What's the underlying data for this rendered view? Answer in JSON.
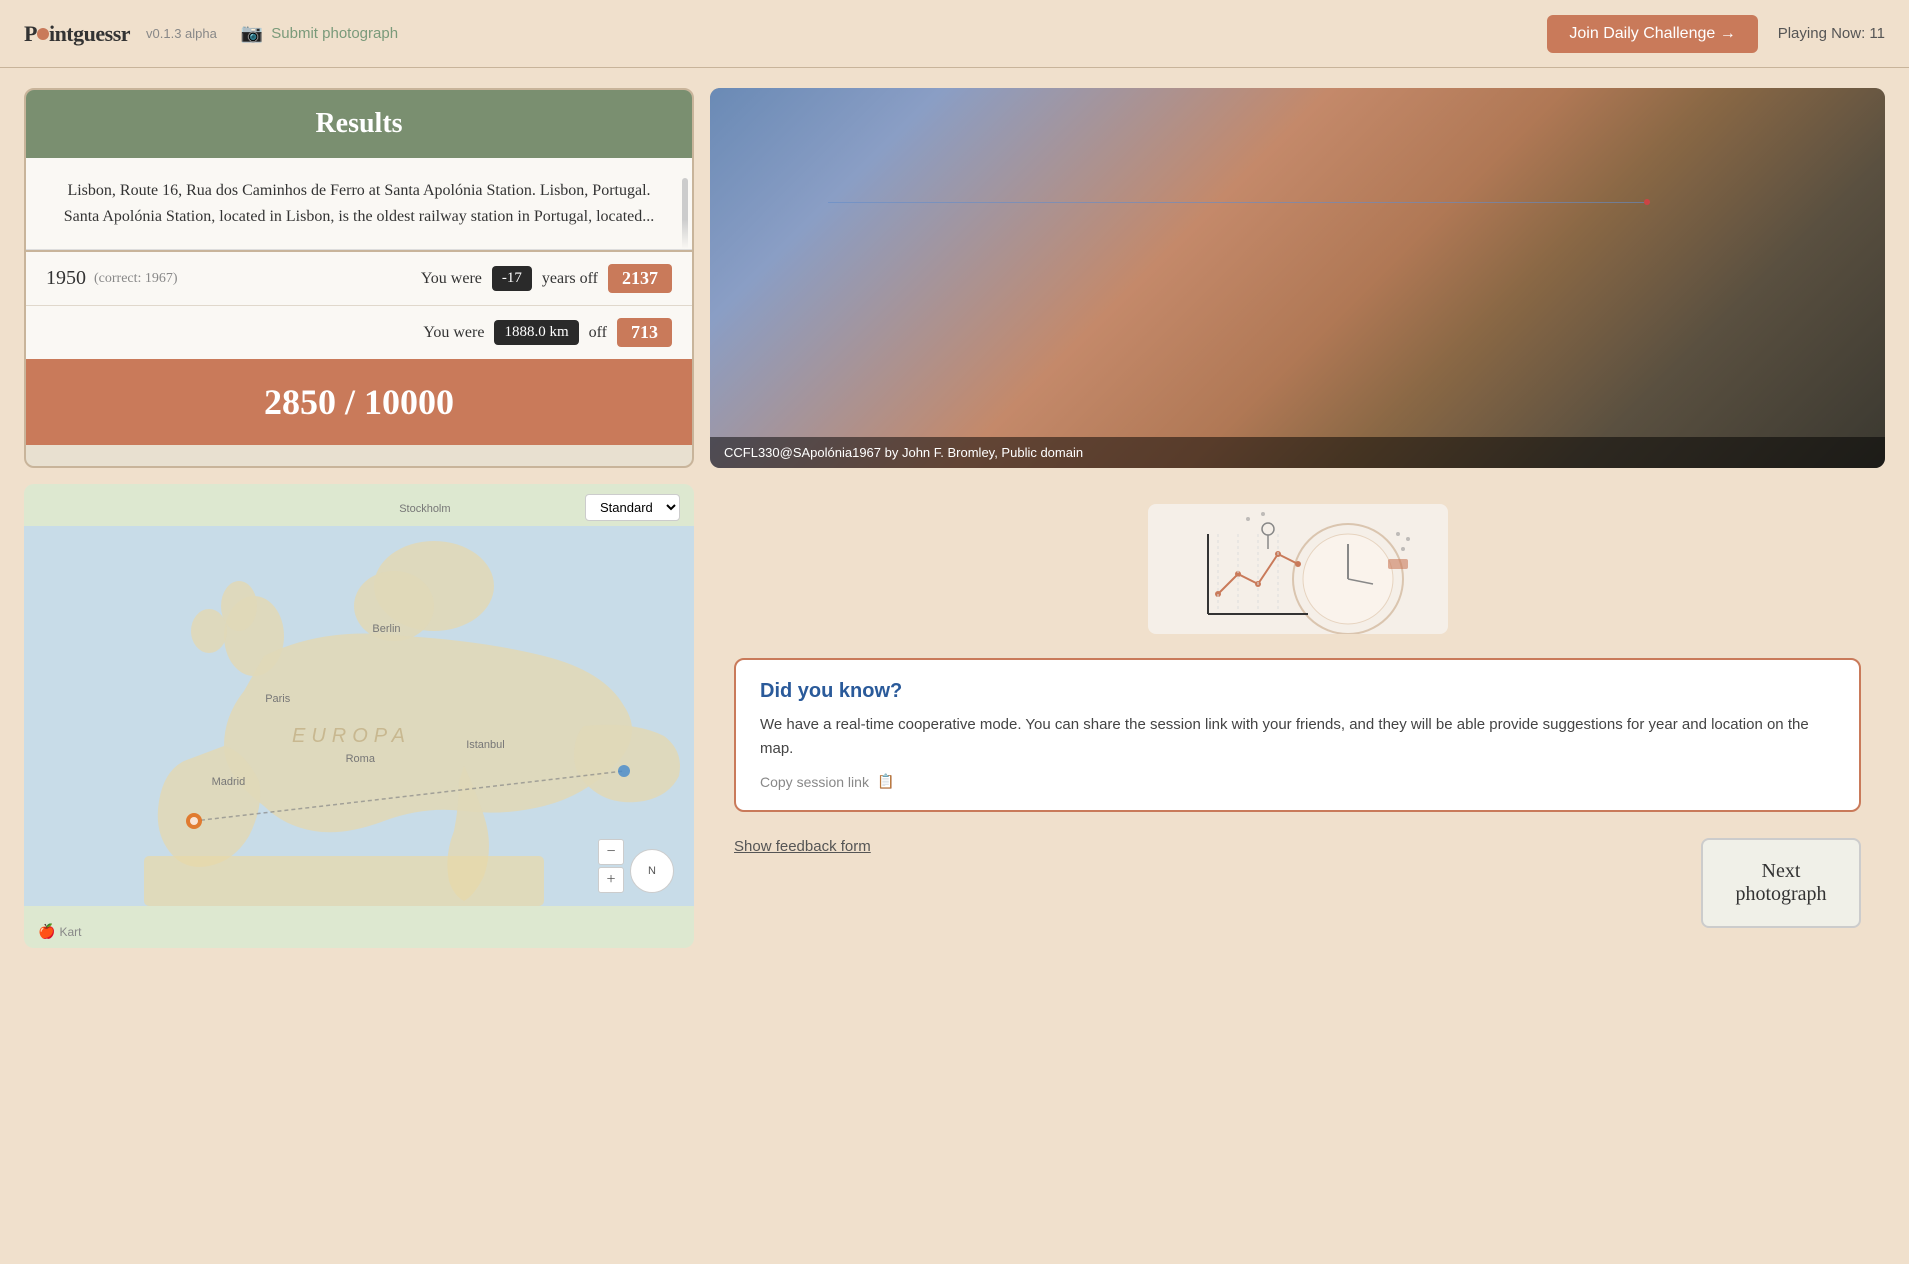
{
  "header": {
    "logo": "Pointguessr",
    "version": "v0.1.3 alpha",
    "submit_photo": "Submit photograph",
    "join_challenge": "Join Daily Challenge →",
    "playing_now": "Playing Now: 11"
  },
  "results": {
    "title": "Results",
    "description": "Lisbon, Route 16, Rua dos Caminhos de Ferro at Santa Apolónia Station. Lisbon, Portugal. Santa Apolónia Station, located in Lisbon, is the oldest railway station in Portugal, located...",
    "year_guess": "1950",
    "year_correct": "(correct: 1967)",
    "year_off_label": "You were",
    "year_off_value": "-17",
    "year_off_suffix": "years off",
    "year_score": "2137",
    "distance_label": "You were",
    "distance_value": "1888.0 km",
    "distance_suffix": "off",
    "distance_score": "713",
    "total_score": "2850 / 10000"
  },
  "photo": {
    "credit": "CCFL330@SApolónia1967 by John F. Bromley, Public domain"
  },
  "map": {
    "dropdown": "Standard",
    "labels": {
      "stockholm": "Stockholm",
      "berlin": "Berlin",
      "paris": "Paris",
      "madrid": "Madrid",
      "roma": "Roma",
      "istanbul": "Istanbul",
      "europa": "EUROPA"
    },
    "credit": "Kart"
  },
  "did_you_know": {
    "title": "Did you know?",
    "text": "We have a real-time cooperative mode. You can share the session link with your friends, and they will be able provide suggestions for year and location on the map.",
    "copy_link": "Copy session link",
    "show_feedback": "Show feedback form"
  },
  "next_button": {
    "label": "Next\nphotograph",
    "line1": "Next",
    "line2": "photograph"
  }
}
